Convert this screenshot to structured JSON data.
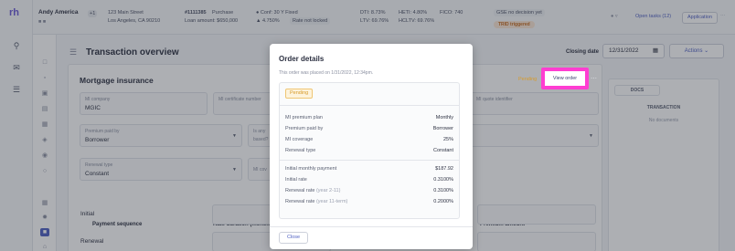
{
  "app": {
    "logo": "rh"
  },
  "header": {
    "borrower_name": "Andy America",
    "borrower_badge": "+1",
    "address_line1": "123 Main Street",
    "address_line2": "Los Angeles, CA 90210",
    "loan_id": "#1111385",
    "loan_purpose": "Purchase",
    "loan_amount": "Loan amount: $650,000",
    "rate_info": "Conf: 30 Y Fixed",
    "rate_value": "4.750%",
    "rate_status": "Rate not locked",
    "dti": "DTI: 8.73%",
    "ltv": "LTV: 69.76%",
    "heti": "HETI: 4.80%",
    "hcltv": "HCLTV: 69.76%",
    "fico": "FICO: 740",
    "decision_note": "GSE no decision yet",
    "trid_badge": "TRID triggered",
    "open_tasks": "Open tasks (12)",
    "application": "Application"
  },
  "main": {
    "page_title": "Transaction overview",
    "closing_label": "Closing date",
    "closing_date": "12/31/2022",
    "actions_label": "Actions",
    "section_title": "Mortgage insurance",
    "pending_label": "Pending",
    "view_order_label": "View order",
    "fields": {
      "mi_company_label": "MI company",
      "mi_company_value": "MGIC",
      "mi_certificate_label": "MI certificate number",
      "mi_quote_label": "MI quote identifier",
      "premium_paid_by_label": "Premium paid by",
      "premium_paid_by_value": "Borrower",
      "is_any_label": "Is any",
      "based_label": "based?",
      "renewal_type_label": "Renewal type",
      "renewal_type_value": "Constant",
      "mi_cov_label": "MI cov"
    },
    "table": {
      "col_payment_sequence": "Payment sequence",
      "col_rate_duration": "Rate duration (months)",
      "col_premium_amount": "Premium amount",
      "rows": [
        "Initial",
        "Renewal"
      ]
    }
  },
  "docs": {
    "tab_label": "DOCS",
    "section_label": "TRANSACTION",
    "empty_text": "No documents"
  },
  "modal": {
    "title": "Order details",
    "subtitle": "This order was placed on 1/31/2022, 12:34pm.",
    "status": "Pending",
    "rows": [
      {
        "label": "MI premium plan",
        "muted": "",
        "value": "Monthly"
      },
      {
        "label": "Premium paid by",
        "muted": "",
        "value": "Borrower"
      },
      {
        "label": "MI coverage",
        "muted": "",
        "value": "25%"
      },
      {
        "label": "Renewal type",
        "muted": "",
        "value": "Constant"
      },
      {
        "label": "Initial monthly payment",
        "muted": "",
        "value": "$187.92"
      },
      {
        "label": "Initial rate",
        "muted": "",
        "value": "0.3100%"
      },
      {
        "label": "Renewal rate",
        "muted": "(year 2-11)",
        "value": "0.3100%"
      },
      {
        "label": "Renewal rate",
        "muted": "(year 11-term)",
        "value": "0.2000%"
      }
    ],
    "close_label": "Close"
  },
  "colors": {
    "accent": "#4e5fc2",
    "highlight": "#ff3dd1",
    "pending": "#d79b2a",
    "trid": "#c46a1e"
  }
}
